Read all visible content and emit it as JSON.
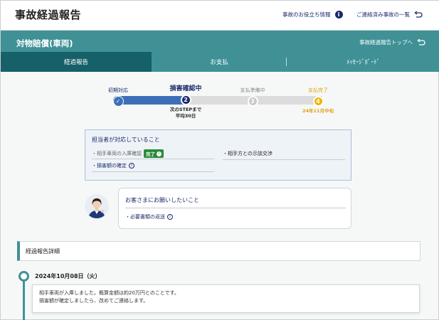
{
  "header": {
    "title": "事故経過報告",
    "links": [
      {
        "label": "事故のお役立ち情報",
        "icon": "info-icon"
      },
      {
        "label": "ご連絡済み事故の一覧",
        "icon": "return-arrow-icon"
      }
    ]
  },
  "band": {
    "title": "対物賠償(車両)",
    "top_link": "事故経過報告トップへ",
    "top_link_icon": "return-arrow-icon"
  },
  "tabs": [
    {
      "label": "経過報告",
      "active": true
    },
    {
      "label": "お支払",
      "active": false
    },
    {
      "label": "ﾒｯｾｰｼﾞﾎﾞｰﾄﾞ",
      "active": false
    }
  ],
  "stepper": {
    "steps": [
      {
        "label": "初期対応",
        "state": "done",
        "number": ""
      },
      {
        "label": "損害確認中",
        "state": "current",
        "number": "2",
        "note": [
          "次のSTEPまで",
          "平均30日"
        ]
      },
      {
        "label": "支払準備中",
        "state": "pending",
        "number": "3"
      },
      {
        "label": "支払完了",
        "state": "final",
        "number": "4",
        "note": [
          "24年11月中旬"
        ]
      }
    ],
    "colors": {
      "done": "#3c6fb8",
      "current": "#1b2a6b",
      "pending": "#c9c9c9",
      "final": "#f0b400"
    }
  },
  "status": {
    "heading": "担当者が対応していること",
    "items": [
      {
        "label": "・相手車両の入庫確認",
        "badge": "完了",
        "state": "done"
      },
      {
        "label": "・損害額の確定",
        "info": true,
        "state": "active"
      },
      {
        "label": "・相手方との示談交渉",
        "state": "active"
      }
    ]
  },
  "request": {
    "heading": "お客さまにお願いしたいこと",
    "items": [
      {
        "label": "・必要書類の返送",
        "info": true
      }
    ]
  },
  "details": {
    "heading": "経過報告詳細",
    "entries": [
      {
        "date": "2024年10月08日（火）",
        "lines": [
          "相手車両が入庫しました。概算金額は約20万円とのことです。",
          "損害額が確定しましたら、改めてご連絡します。"
        ]
      }
    ]
  }
}
